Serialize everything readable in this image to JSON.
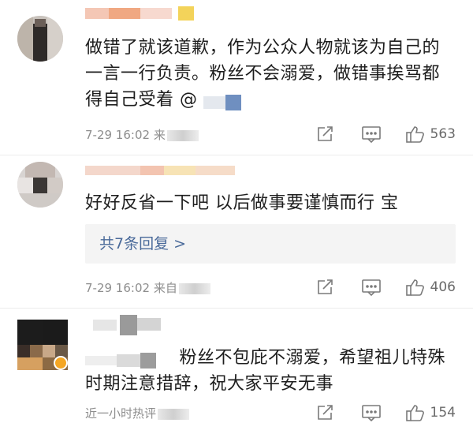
{
  "comments": [
    {
      "text_lines": [
        "做错了就该道歉，作为公众人物就该为自己的",
        "一言一行负责。粉丝不会溺爱，做错事挨骂都",
        "得自己受着 @"
      ],
      "time": "7-29 16:02",
      "source": "来",
      "likes": "563"
    },
    {
      "text_lines": [
        "好好反省一下吧 以后做事要谨慎而行 宝"
      ],
      "replies_label": "共7条回复 >",
      "time": "7-29 16:02",
      "source": "来自",
      "likes": "406"
    },
    {
      "text_lines": [
        "粉丝不包庇不溺爱，希望祖儿特殊",
        "时期注意措辞，祝大家平安无事"
      ],
      "time": "近一小时热评",
      "likes": "154"
    }
  ],
  "icons": {
    "share": "share-icon",
    "comment": "comment-icon",
    "like": "thumbs-up-icon"
  },
  "colors": {
    "meta_text": "#8e8e8e",
    "reply_link": "#4a6a9a",
    "icon": "#7a7a7a",
    "verified_badge": "#f5a623"
  }
}
